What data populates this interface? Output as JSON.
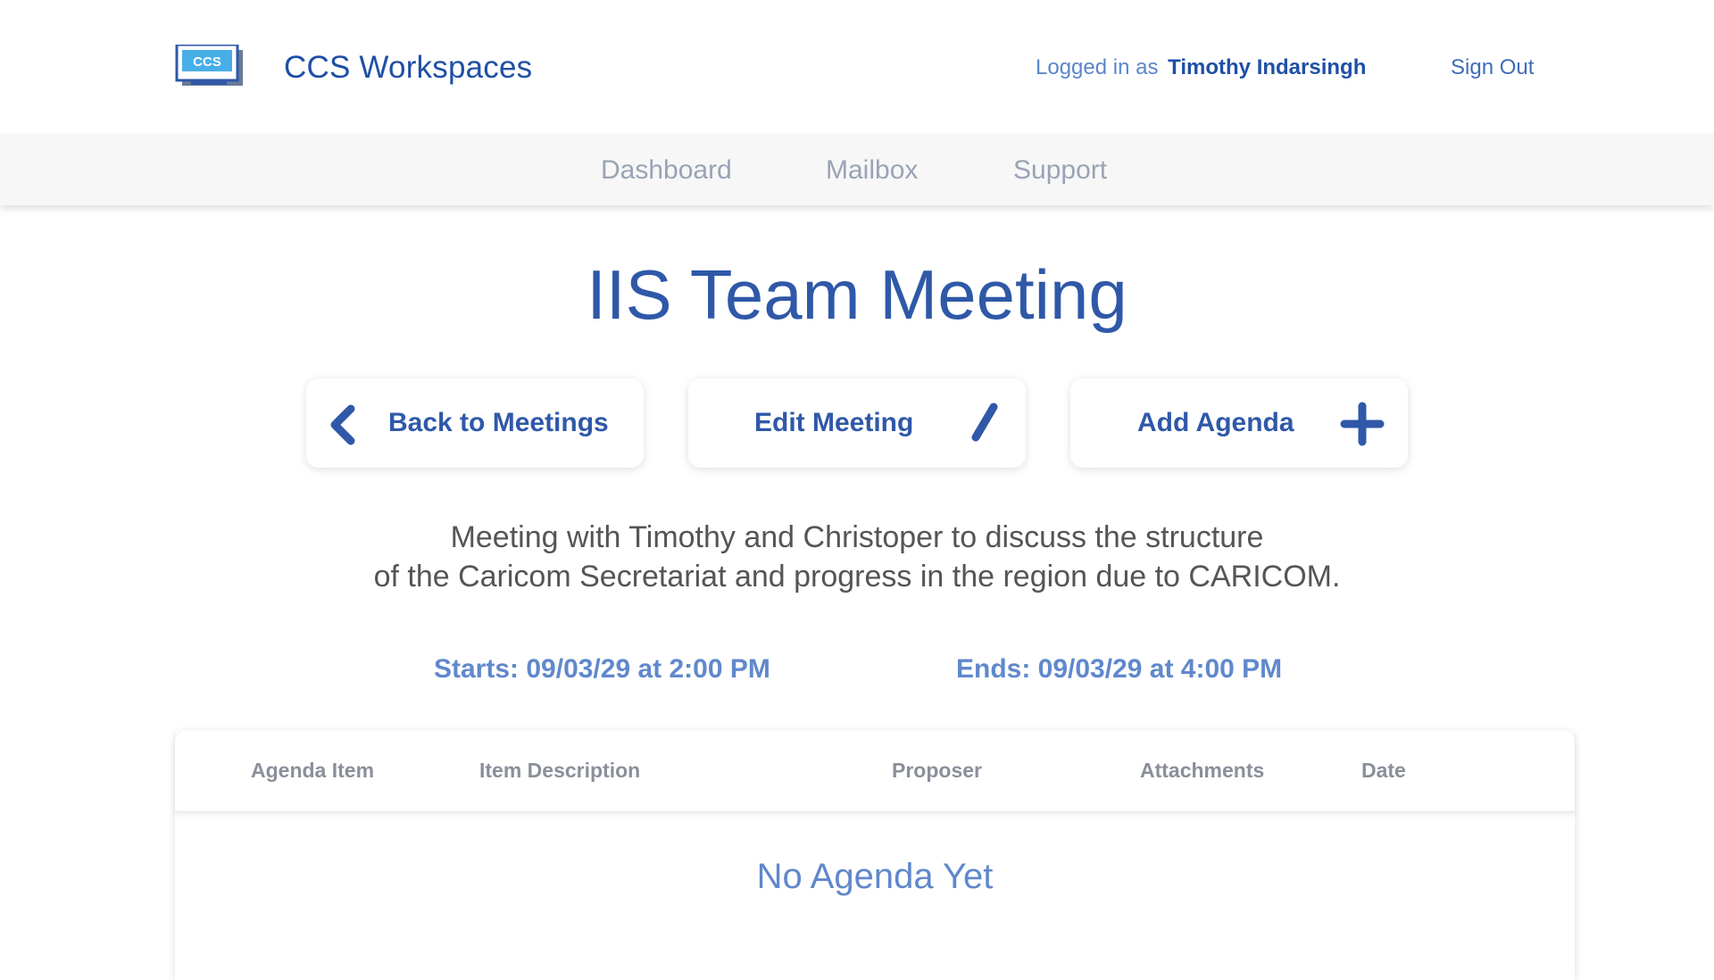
{
  "header": {
    "brand": "CCS Workspaces",
    "logo_text": "CCS",
    "logged_in_prefix": "Logged in as",
    "user_name": "Timothy Indarsingh",
    "sign_out": "Sign Out"
  },
  "nav": {
    "items": [
      {
        "label": "Dashboard"
      },
      {
        "label": "Mailbox"
      },
      {
        "label": "Support"
      }
    ]
  },
  "meeting": {
    "title": "IIS Team Meeting",
    "description_line1": "Meeting with Timothy and Christoper to discuss the structure",
    "description_line2": "of the Caricom Secretariat and progress in the region due to CARICOM.",
    "starts": "Starts: 09/03/29 at 2:00 PM",
    "ends": "Ends: 09/03/29 at 4:00 PM"
  },
  "actions": {
    "back_label": "Back to Meetings",
    "back_icon": "chevron-left-icon",
    "edit_label": "Edit Meeting",
    "edit_icon": "pencil-icon",
    "add_label": "Add Agenda",
    "add_icon": "plus-icon"
  },
  "agenda_table": {
    "columns": [
      "Agenda Item",
      "Item Description",
      "Proposer",
      "Attachments",
      "Date"
    ],
    "empty_text": "No Agenda Yet"
  },
  "colors": {
    "primary": "#2f58a8",
    "brand": "#1f4fa6",
    "accent_light": "#6088cc",
    "nav_text": "#9aa3b5",
    "nav_bg": "#f7f7f7"
  }
}
